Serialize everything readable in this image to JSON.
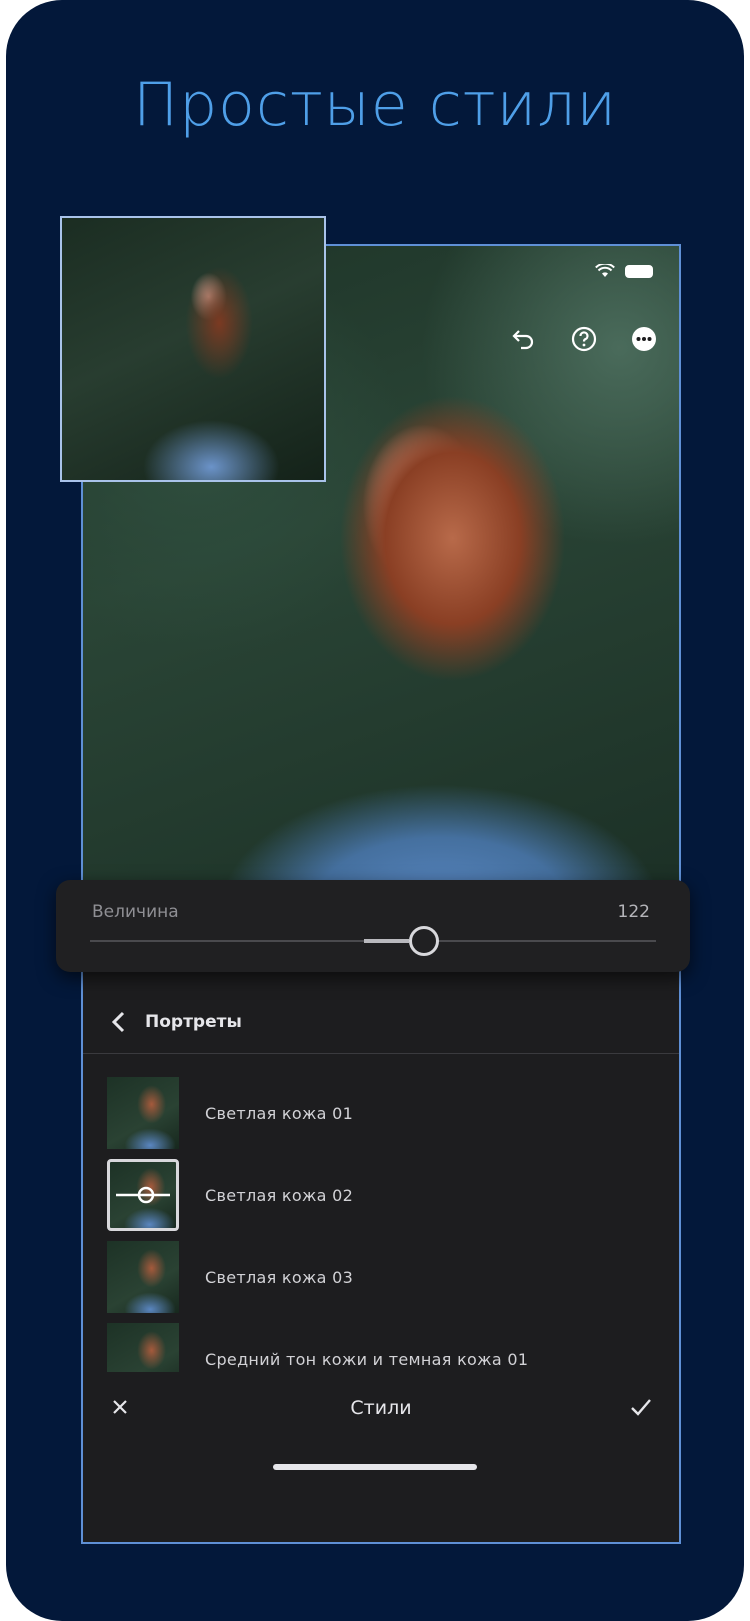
{
  "headline": "Простые стили",
  "toolbar": {
    "undo_icon": "undo-icon",
    "help_icon": "help-icon",
    "more_icon": "more-icon"
  },
  "slider": {
    "label": "Величина",
    "value": "122",
    "fraction": 0.59
  },
  "list": {
    "title": "Портреты",
    "items": [
      {
        "label": "Светлая кожа 01",
        "selected": false
      },
      {
        "label": "Светлая кожа 02",
        "selected": true
      },
      {
        "label": "Светлая кожа 03",
        "selected": false
      },
      {
        "label": "Средний тон кожи и темная кожа 01",
        "selected": false
      }
    ]
  },
  "bottom_bar": {
    "title": "Стили"
  },
  "colors": {
    "background": "#03183a",
    "accent": "#4f9fe8",
    "panel": "#1d1d1f"
  }
}
